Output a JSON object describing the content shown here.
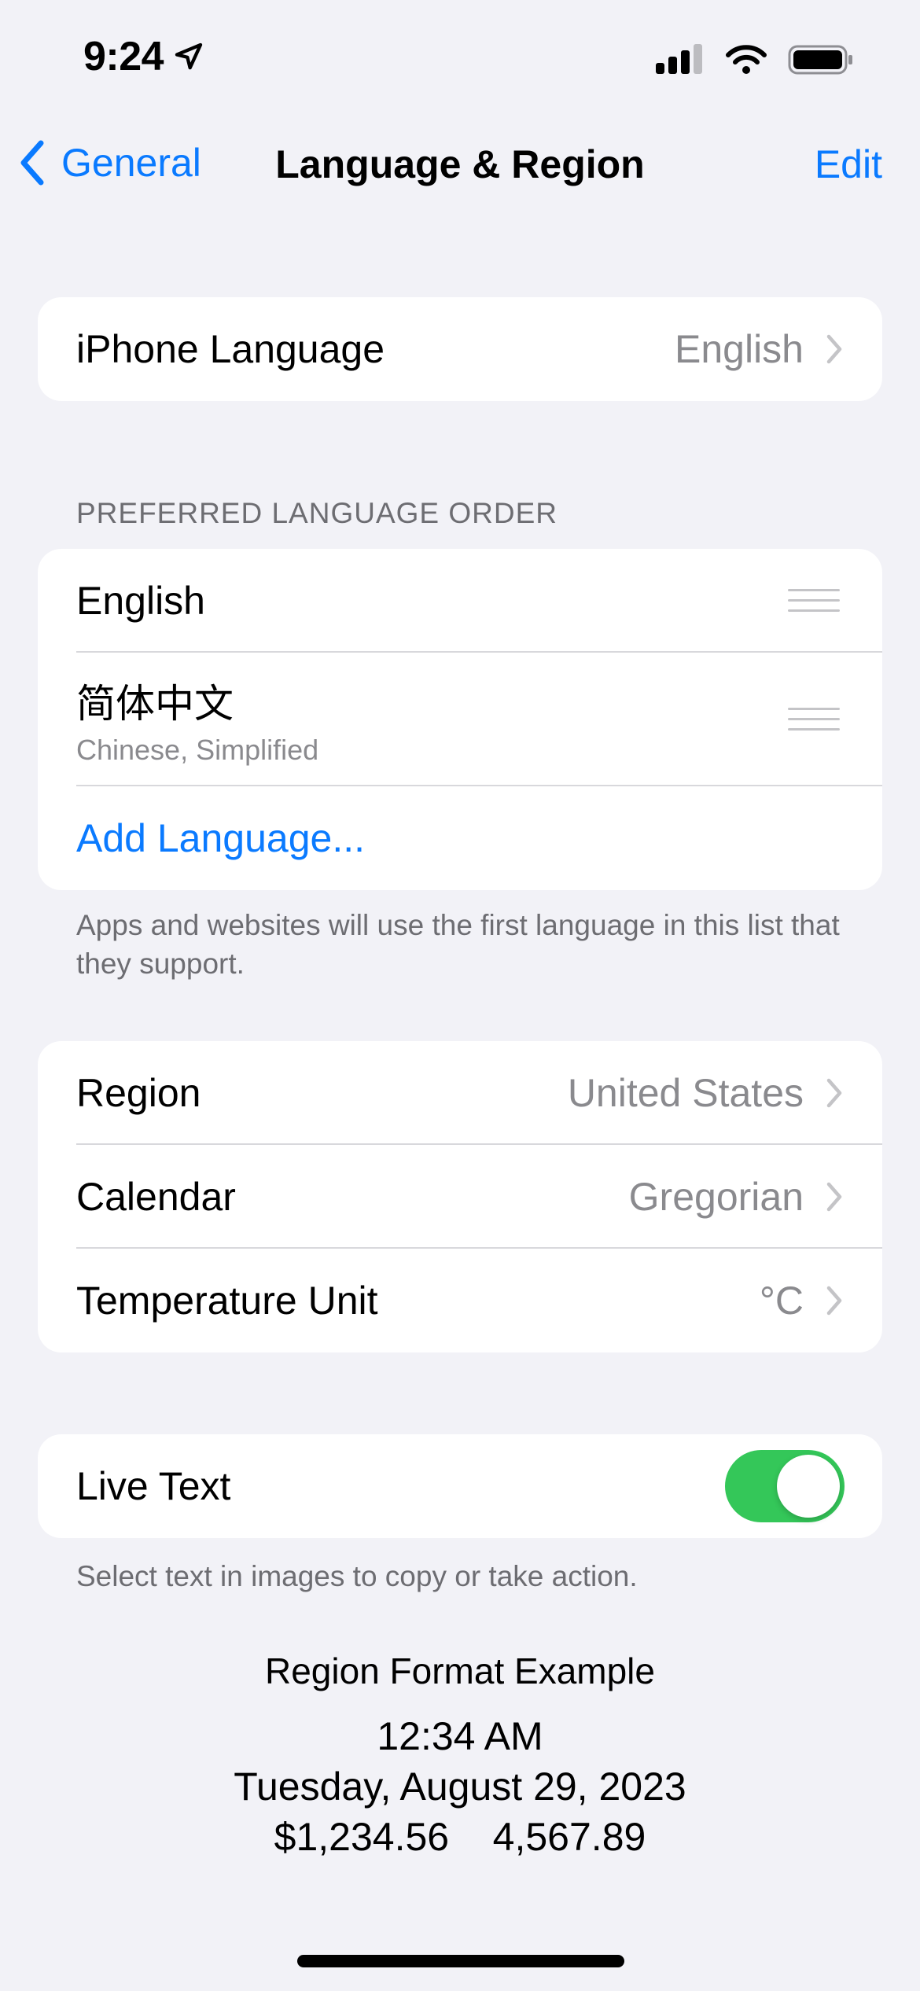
{
  "status_bar": {
    "time": "9:24",
    "icons": [
      "location-arrow-icon",
      "cellular-signal-icon",
      "wifi-icon",
      "battery-icon"
    ]
  },
  "nav": {
    "back_label": "General",
    "title": "Language & Region",
    "edit_label": "Edit"
  },
  "iphone_language": {
    "label": "iPhone Language",
    "value": "English"
  },
  "preferred": {
    "header": "PREFERRED LANGUAGE ORDER",
    "languages": [
      {
        "name": "English",
        "subtitle": ""
      },
      {
        "name": "简体中文",
        "subtitle": "Chinese, Simplified"
      }
    ],
    "add_label": "Add Language...",
    "footnote": "Apps and websites will use the first language in this list that they support."
  },
  "region_group": {
    "items": [
      {
        "label": "Region",
        "value": "United States"
      },
      {
        "label": "Calendar",
        "value": "Gregorian"
      },
      {
        "label": "Temperature Unit",
        "value": "°C"
      }
    ]
  },
  "live_text": {
    "label": "Live Text",
    "enabled": true,
    "accent_color": "#34c759",
    "footnote": "Select text in images to copy or take action."
  },
  "region_example": {
    "title": "Region Format Example",
    "time": "12:34 AM",
    "date": "Tuesday, August 29, 2023",
    "numbers": "$1,234.56    4,567.89"
  },
  "colors": {
    "link": "#0a7aff",
    "background": "#f2f2f7"
  }
}
